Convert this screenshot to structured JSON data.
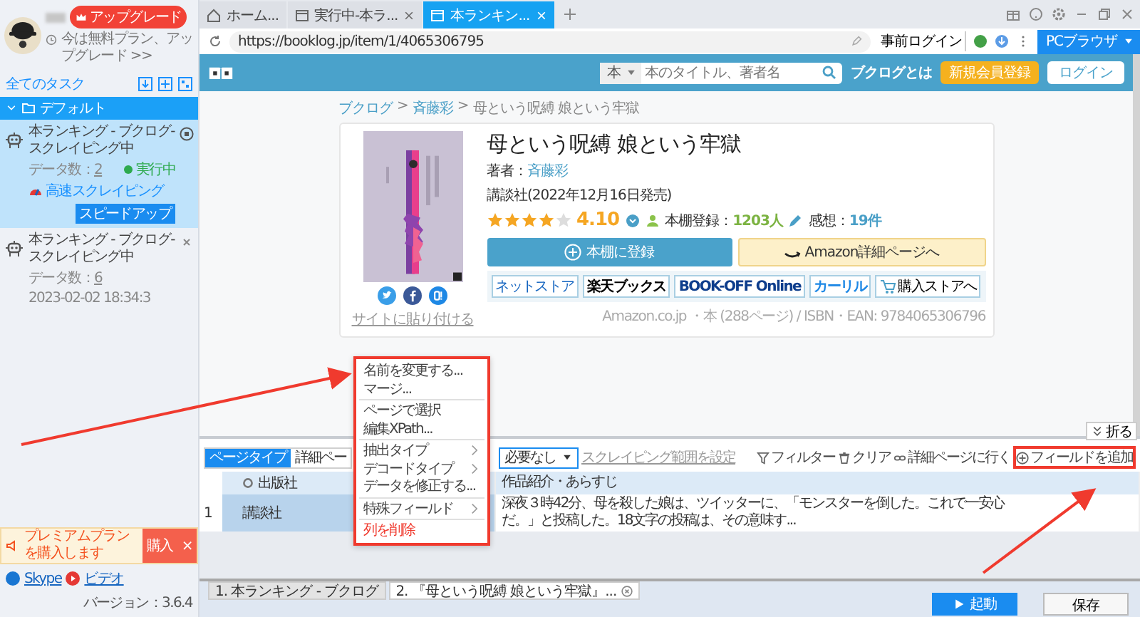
{
  "sidebar": {
    "user": {
      "upgrade": "アップグレード",
      "plan": "今は無料プラン、アップグレード >>"
    },
    "all_tasks": "全てのタスク",
    "group": {
      "label": "デフォルト",
      "expanded": true,
      "tasks": [
        {
          "title": "本ランキング - ブクログ-スクレイピング中",
          "data_label": "データ数：",
          "count": "2",
          "status": "実行中",
          "selected": true,
          "speed": "高速スクレイピング",
          "speed_button": "スピードアップ"
        },
        {
          "title": "本ランキング - ブクログ-スクレイピング中",
          "data_label": "データ数：",
          "count": "6",
          "time": "2023-02-02 18:34:3",
          "selected": false
        }
      ]
    },
    "promo": {
      "text": "プレミアムプランを購入します",
      "button": "購入",
      "close": "×"
    },
    "footer": {
      "links": [
        "Skype",
        "ビデオ"
      ],
      "version": "バージョン：3.6.4"
    }
  },
  "browser": {
    "tabs": [
      {
        "label": "ホーム...",
        "kind": "home",
        "selected": false
      },
      {
        "label": "実行中-本ラ...",
        "kind": "page",
        "selected": false
      },
      {
        "label": "本ランキン...",
        "kind": "page",
        "selected": true
      }
    ],
    "url": "https://booklog.jp/item/1/4065306795",
    "prelogin": "事前ログイン",
    "mode": "PCブラウザ"
  },
  "site": {
    "search": {
      "category": "本",
      "placeholder": "本のタイトル、著者名"
    },
    "about": "ブクログとは",
    "register": "新規会員登録",
    "login": "ログイン",
    "breadcrumb": [
      "ブクログ",
      "斉藤彩",
      "母という呪縛 娘という牢獄"
    ],
    "breadcrumb_separator": ">",
    "book": {
      "title": "母という呪縛 娘という牢獄",
      "author_label": "著者：",
      "author": "斉藤彩",
      "publisher": "講談社(2022年12月16日発売)",
      "stars": 4,
      "rating": "4.10",
      "shelf_label": "本棚登録：",
      "shelf_count": "1203人",
      "review_label": "感想：",
      "review_count": "19件",
      "shelf_button": "本棚に登録",
      "amazon_button": "Amazon詳細ページへ",
      "stores": [
        "ネットストア",
        "楽天ブックス",
        "BOOK-OFF Online",
        "カーリル",
        "購入ストアへ"
      ],
      "paste_link": "サイトに貼り付ける",
      "meta": "Amazon.co.jp ・本 (288ページ) / ISBN・EAN: 9784065306796"
    }
  },
  "context_menu": {
    "groups": [
      [
        {
          "label": "名前を変更する...",
          "submenu": false,
          "danger": false
        },
        {
          "label": "マージ...",
          "submenu": false,
          "danger": false
        }
      ],
      [
        {
          "label": "ページで選択",
          "submenu": false,
          "danger": false
        },
        {
          "label": "編集XPath...",
          "submenu": false,
          "danger": false
        }
      ],
      [
        {
          "label": "抽出タイプ",
          "submenu": true,
          "danger": false
        },
        {
          "label": "デコードタイプ",
          "submenu": true,
          "danger": false
        },
        {
          "label": "データを修正する...",
          "submenu": false,
          "danger": false
        }
      ],
      [
        {
          "label": "特殊フィールド",
          "submenu": true,
          "danger": false
        }
      ],
      [
        {
          "label": "列を削除",
          "submenu": false,
          "danger": true
        }
      ]
    ]
  },
  "panel": {
    "collapse": "折る",
    "page_type": {
      "label": "ページタイプ",
      "value": "詳細ペー"
    },
    "paging": "必要なし",
    "range_link": "スクレイピング範囲を設定",
    "actions": [
      {
        "label": "フィルター",
        "kind": "filter",
        "highlighted": false
      },
      {
        "label": "クリア",
        "kind": "clear",
        "highlighted": false
      },
      {
        "label": "詳細ページに行く",
        "kind": "link",
        "highlighted": false
      },
      {
        "label": "フィールドを追加",
        "kind": "add",
        "highlighted": true
      }
    ],
    "table": {
      "columns": [
        "出版社",
        "作品紹介・あらすじ"
      ],
      "rows": [
        {
          "index": "1",
          "cells": [
            "講談社",
            "深夜３時42分、母を殺した娘は、ツイッターに、「モンスターを倒した。これで一安心だ。」と投稿した。18文字の投稿は、その意味す..."
          ]
        }
      ]
    }
  },
  "bottom": {
    "tabs": [
      {
        "label": "1. 本ランキング - ブクログ",
        "selected": false,
        "closable": false
      },
      {
        "label": "2. 『母という呪縛 娘という牢獄』...",
        "selected": true,
        "closable": true
      }
    ],
    "start": "起動",
    "save": "保存"
  }
}
